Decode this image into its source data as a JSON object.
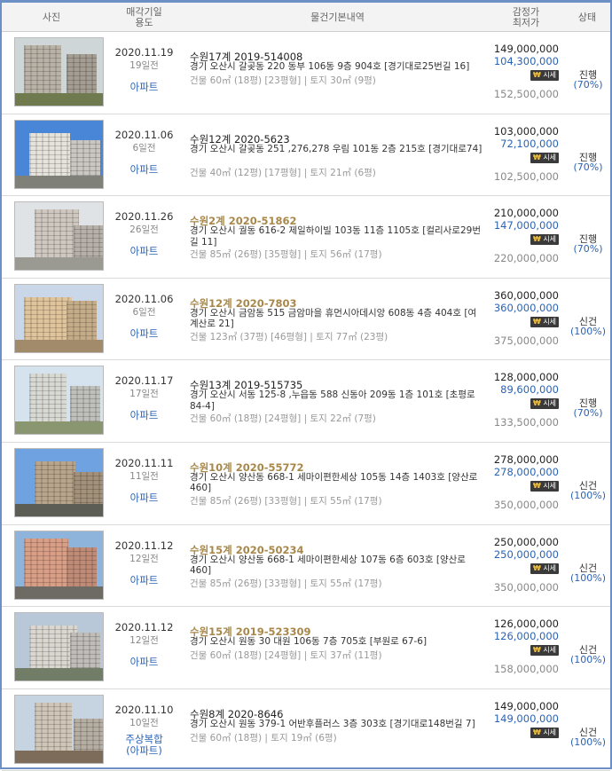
{
  "header": {
    "photo": "사진",
    "date_use": [
      "매각기일",
      "용도"
    ],
    "details": "물건기본내역",
    "price": [
      "감정가",
      "최저가"
    ],
    "status": "상태"
  },
  "badge_label": "시세",
  "rows": [
    {
      "date": "2020.11.19",
      "ago": "19일전",
      "use": "아파트",
      "case": "수원17계 2019-514008",
      "case_highlight": false,
      "address": "경기 오산시 갈곶동 220 동부 106동 9층 904호 [경기대로25번길 16]",
      "area": "건물 60㎡ (18평) [23평형]  |  토지 30㎡ (9평)",
      "appraisal": "149,000,000",
      "minimum": "104,300,000",
      "market": "152,500,000",
      "status": "진행",
      "rate": "(70%)"
    },
    {
      "date": "2020.11.06",
      "ago": "6일전",
      "use": "아파트",
      "case": "수원12계 2020-5623",
      "case_highlight": false,
      "address": "경기 오산시 갈곶동 251 ,276,278 우림 101동 2층 215호 [경기대로74]",
      "area": "건물 40㎡ (12평) [17평형]  |  토지 21㎡ (6평)",
      "appraisal": "103,000,000",
      "minimum": "72,100,000",
      "market": "102,500,000",
      "status": "진행",
      "rate": "(70%)"
    },
    {
      "date": "2020.11.26",
      "ago": "26일전",
      "use": "아파트",
      "case": "수원2계 2020-51862",
      "case_highlight": true,
      "address": "경기 오산시 궐동 616-2 제일하이빌 103동 11층 1105호 [컬리사로29번길 11]",
      "area": "건물 85㎡ (26평) [35평형]  |  토지 56㎡ (17평)",
      "appraisal": "210,000,000",
      "minimum": "147,000,000",
      "market": "220,000,000",
      "status": "진행",
      "rate": "(70%)"
    },
    {
      "date": "2020.11.06",
      "ago": "6일전",
      "use": "아파트",
      "case": "수원12계 2020-7803",
      "case_highlight": true,
      "address": "경기 오산시 금암동 515 금암마을 휴먼시아데시앙 608동 4층 404호 [여계산로 21]",
      "area": "건물 123㎡ (37평) [46평형]  |  토지 77㎡ (23평)",
      "appraisal": "360,000,000",
      "minimum": "360,000,000",
      "market": "375,000,000",
      "status": "신건",
      "rate": "(100%)"
    },
    {
      "date": "2020.11.17",
      "ago": "17일전",
      "use": "아파트",
      "case": "수원13계 2019-515735",
      "case_highlight": false,
      "address": "경기 오산시 서동 125-8 ,누읍동 588 신동아 209동 1층 101호 [초평로84-4]",
      "area": "건물 60㎡ (18평) [24평형]  |  토지 22㎡ (7평)",
      "appraisal": "128,000,000",
      "minimum": "89,600,000",
      "market": "133,500,000",
      "status": "진행",
      "rate": "(70%)"
    },
    {
      "date": "2020.11.11",
      "ago": "11일전",
      "use": "아파트",
      "case": "수원10계 2020-55772",
      "case_highlight": true,
      "address": "경기 오산시 양산동 668-1 세마이편한세상 105동 14층 1403호 [양산로460]",
      "area": "건물 85㎡ (26평) [33평형]  |  토지 55㎡ (17평)",
      "appraisal": "278,000,000",
      "minimum": "278,000,000",
      "market": "350,000,000",
      "status": "신건",
      "rate": "(100%)"
    },
    {
      "date": "2020.11.12",
      "ago": "12일전",
      "use": "아파트",
      "case": "수원15계 2020-50234",
      "case_highlight": true,
      "address": "경기 오산시 양산동 668-1 세마이편한세상 107동 6층 603호 [양산로460]",
      "area": "건물 85㎡ (26평) [33평형]  |  토지 55㎡ (17평)",
      "appraisal": "250,000,000",
      "minimum": "250,000,000",
      "market": "350,000,000",
      "status": "신건",
      "rate": "(100%)"
    },
    {
      "date": "2020.11.12",
      "ago": "12일전",
      "use": "아파트",
      "case": "수원15계 2019-523309",
      "case_highlight": true,
      "address": "경기 오산시 원동 30 대원 106동 7층 705호 [부원로 67-6]",
      "area": "건물 60㎡ (18평) [24평형]  |  토지 37㎡ (11평)",
      "appraisal": "126,000,000",
      "minimum": "126,000,000",
      "market": "158,000,000",
      "status": "신건",
      "rate": "(100%)"
    },
    {
      "date": "2020.11.10",
      "ago": "10일전",
      "use": "주상복합\n(아파트)",
      "case": "수원8계 2020-8646",
      "case_highlight": false,
      "address": "경기 오산시 원동 379-1 어반후플러스 3층 303호 [경기대로148번길 7]",
      "area": "건물 60㎡ (18평)  |  토지 19㎡ (6평)",
      "appraisal": "149,000,000",
      "minimum": "149,000,000",
      "market": "",
      "status": "신건",
      "rate": "(100%)"
    }
  ]
}
